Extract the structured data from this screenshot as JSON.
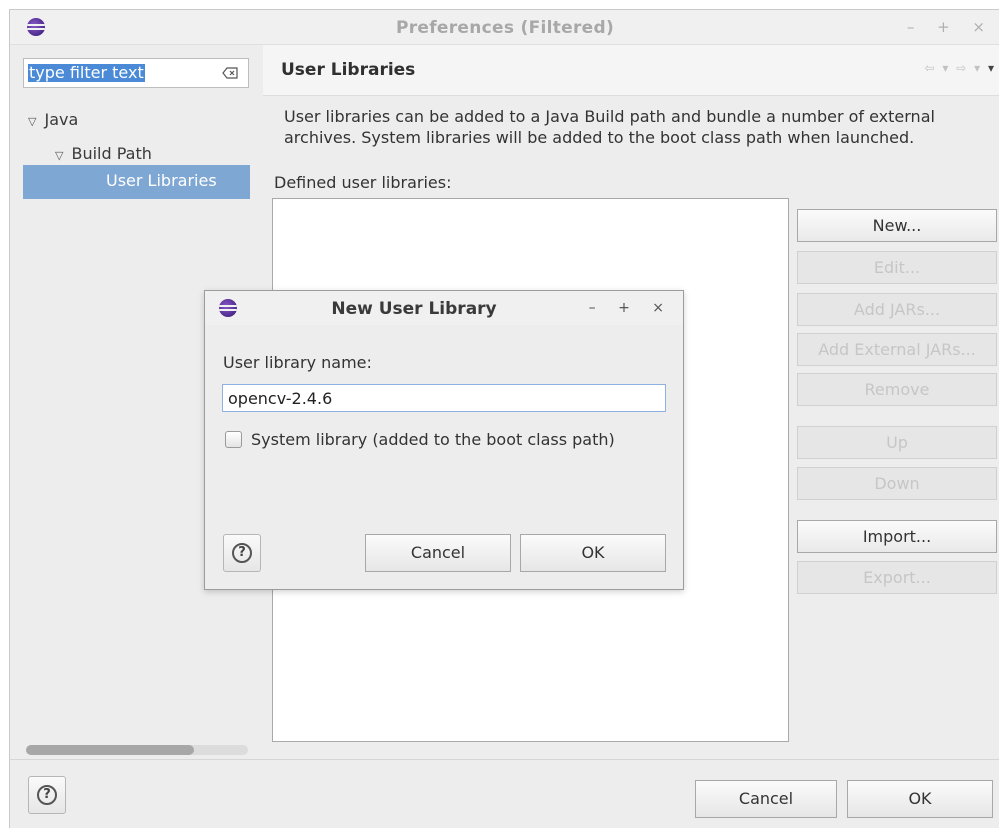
{
  "window": {
    "title": "Preferences (Filtered)",
    "controls": "– + ×"
  },
  "sidebar": {
    "filter_text": "type filter text",
    "tree": [
      {
        "label": "Java",
        "expanded": true
      },
      {
        "label": "Build Path",
        "expanded": true
      },
      {
        "label": "User Libraries",
        "selected": true
      }
    ]
  },
  "page": {
    "title": "User Libraries",
    "description": "User libraries can be added to a Java Build path and bundle a number of external archives. System libraries will be added to the boot class path when launched.",
    "list_label": "Defined user libraries:",
    "buttons": {
      "new": "New...",
      "edit": "Edit...",
      "add_jars": "Add JARs...",
      "add_external_jars": "Add External JARs...",
      "remove": "Remove",
      "up": "Up",
      "down": "Down",
      "import": "Import...",
      "export": "Export..."
    }
  },
  "footer": {
    "cancel": "Cancel",
    "ok": "OK"
  },
  "dialog": {
    "title": "New User Library",
    "controls": "– + ×",
    "name_label": "User library name:",
    "name_value": "opencv-2.4.6",
    "system_library_label": "System library (added to the boot class path)",
    "system_library_checked": false,
    "cancel": "Cancel",
    "ok": "OK"
  },
  "colors": {
    "selection": "#7fa7d3",
    "filter_highlight": "#4a8ad7",
    "eclipse_purple": "#4b2a8c"
  }
}
